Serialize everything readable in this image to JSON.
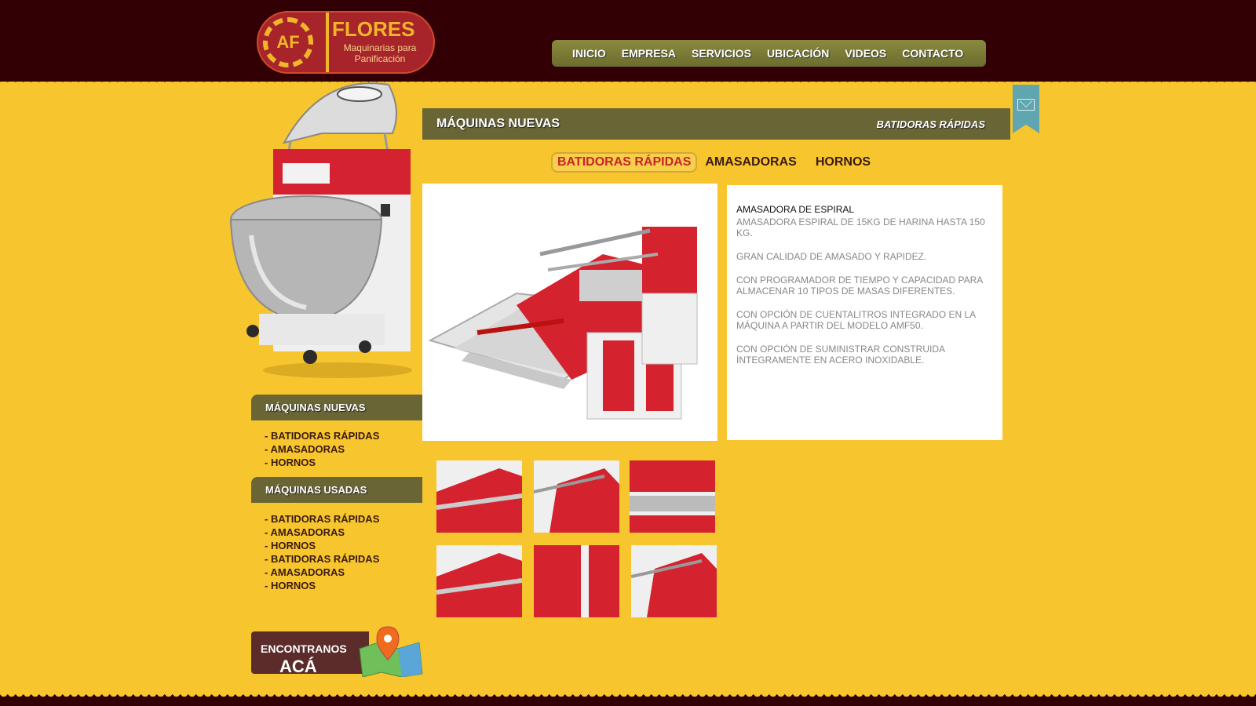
{
  "header": {
    "logo_title": "FLORES",
    "logo_subtitle": "Maquinarias para Panificación",
    "nav": [
      "INICIO",
      "EMPRESA",
      "SERVICIOS",
      "UBICACIÓN",
      "VIDEOS",
      "CONTACTO"
    ]
  },
  "band": {
    "title": "MÁQUINAS NUEVAS",
    "subtitle": "BATIDORAS  RÁPIDAS"
  },
  "tabs": [
    "BATIDORAS RÁPIDAS",
    "AMASADORAS",
    "HORNOS"
  ],
  "description": {
    "title": "AMASADORA DE ESPIRAL",
    "paragraphs": [
      "AMASADORA ESPIRAL DE 15KG DE HARINA HASTA 150 KG.",
      "GRAN CALIDAD DE AMASADO Y RAPIDEZ.",
      "CON PROGRAMADOR DE TIEMPO Y CAPACIDAD PARA ALMACENAR 10 TIPOS DE MASAS DIFERENTES.",
      "CON OPCIÓN DE CUENTALITROS INTEGRADO EN LA MÁQUINA A PARTIR DEL MODELO AMF50.",
      "CON OPCIÓN DE SUMINISTRAR CONSTRUIDA ÍNTEGRAMENTE EN ACERO INOXIDABLE."
    ]
  },
  "sidebar": {
    "new_title": "MÁQUINAS NUEVAS",
    "new_items": [
      "- BATIDORAS  RÁPIDAS",
      "- AMASADORAS",
      "- HORNOS"
    ],
    "used_title": "MÁQUINAS USADAS",
    "used_items": [
      "- BATIDORAS  RÁPIDAS",
      "- AMASADORAS",
      "- HORNOS",
      "- BATIDORAS  RÁPIDAS",
      "- AMASADORAS",
      "- HORNOS"
    ]
  },
  "promo": {
    "line1": "ENCONTRANOS",
    "line2": "ACÁ"
  },
  "colors": {
    "background": "#f7c52e",
    "header": "#320004",
    "band": "#696535",
    "accent_red": "#c8242a"
  },
  "icons": {
    "mail": "mail-icon",
    "map": "map-pin-icon"
  }
}
